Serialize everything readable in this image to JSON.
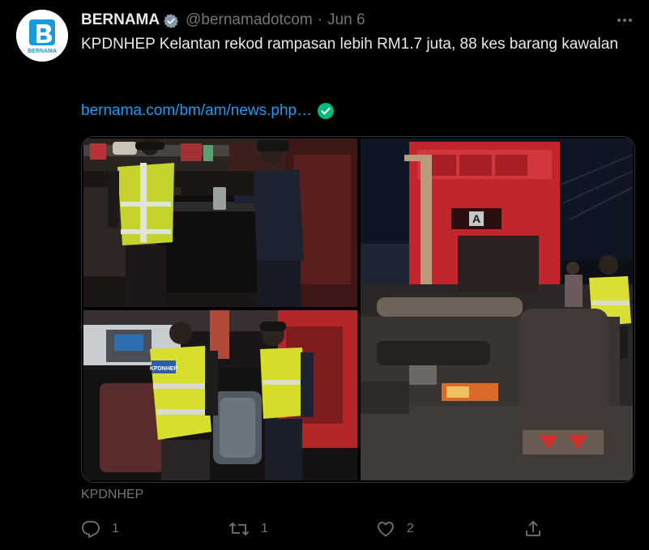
{
  "author": {
    "name": "BERNAMA",
    "handle": "@bernamadotcom",
    "separator": "·",
    "date": "Jun 6",
    "avatar_text": "BERNAMA"
  },
  "tweet": {
    "text": "KPDNHEP Kelantan rekod rampasan lebih RM1.7 juta, 88 kes barang kawalan",
    "link": "bernama.com/bm/am/news.php…"
  },
  "media": {
    "caption": "KPDNHEP",
    "vest_label": "KPDNHEP",
    "truck_plate_letter": "A"
  },
  "stats": {
    "replies": "1",
    "retweets": "1",
    "likes": "2"
  },
  "colors": {
    "background": "#000000",
    "text": "#e7e9ea",
    "muted": "#71767b",
    "link": "#1d9bf0",
    "verified_check": "#00ba7c",
    "brand": "#1b9ad6",
    "vest": "#d9e22a",
    "truck_red": "#c0262c"
  },
  "icons": {
    "verified": "verified-badge-icon",
    "link_check": "check-circle-icon",
    "more": "more-horizontal-icon",
    "reply": "reply-icon",
    "retweet": "retweet-icon",
    "like": "heart-icon",
    "share": "share-icon"
  }
}
